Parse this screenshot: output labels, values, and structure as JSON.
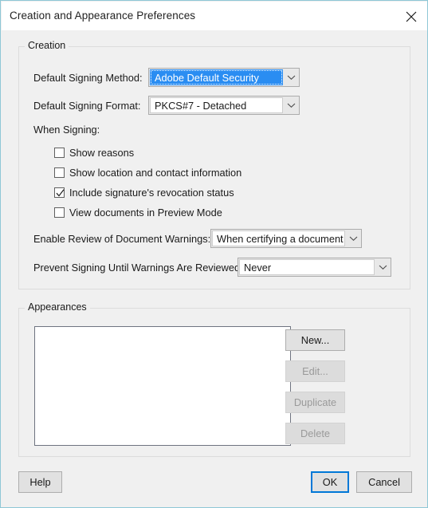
{
  "window": {
    "title": "Creation and Appearance Preferences",
    "close_icon": "close-icon",
    "border_color": "#8ec7d6",
    "body_color": "#f0f0f0"
  },
  "creation": {
    "group_title": "Creation",
    "default_signing_method": {
      "label": "Default Signing Method:",
      "value": "Adobe Default Security",
      "focused": true,
      "highlight_color": "#2a8df2"
    },
    "default_signing_format": {
      "label": "Default Signing Format:",
      "value": "PKCS#7 - Detached"
    },
    "when_signing": {
      "label": "When Signing:",
      "checkboxes": [
        {
          "label": "Show reasons",
          "checked": false
        },
        {
          "label": "Show location and contact information",
          "checked": false
        },
        {
          "label": "Include signature's revocation status",
          "checked": true
        },
        {
          "label": "View documents in Preview Mode",
          "checked": false
        }
      ]
    },
    "enable_review": {
      "label": "Enable Review of Document Warnings:",
      "value": "When certifying a document"
    },
    "prevent_signing": {
      "label": "Prevent Signing Until Warnings Are Reviewed:",
      "value": "Never"
    }
  },
  "appearances": {
    "group_title": "Appearances",
    "list_items": [],
    "buttons": {
      "new": {
        "label": "New...",
        "enabled": true
      },
      "edit": {
        "label": "Edit...",
        "enabled": false
      },
      "duplicate": {
        "label": "Duplicate",
        "enabled": false
      },
      "delete": {
        "label": "Delete",
        "enabled": false
      }
    }
  },
  "footer": {
    "help": "Help",
    "ok": "OK",
    "cancel": "Cancel",
    "default_button": "OK",
    "default_border_color": "#0078d7"
  }
}
